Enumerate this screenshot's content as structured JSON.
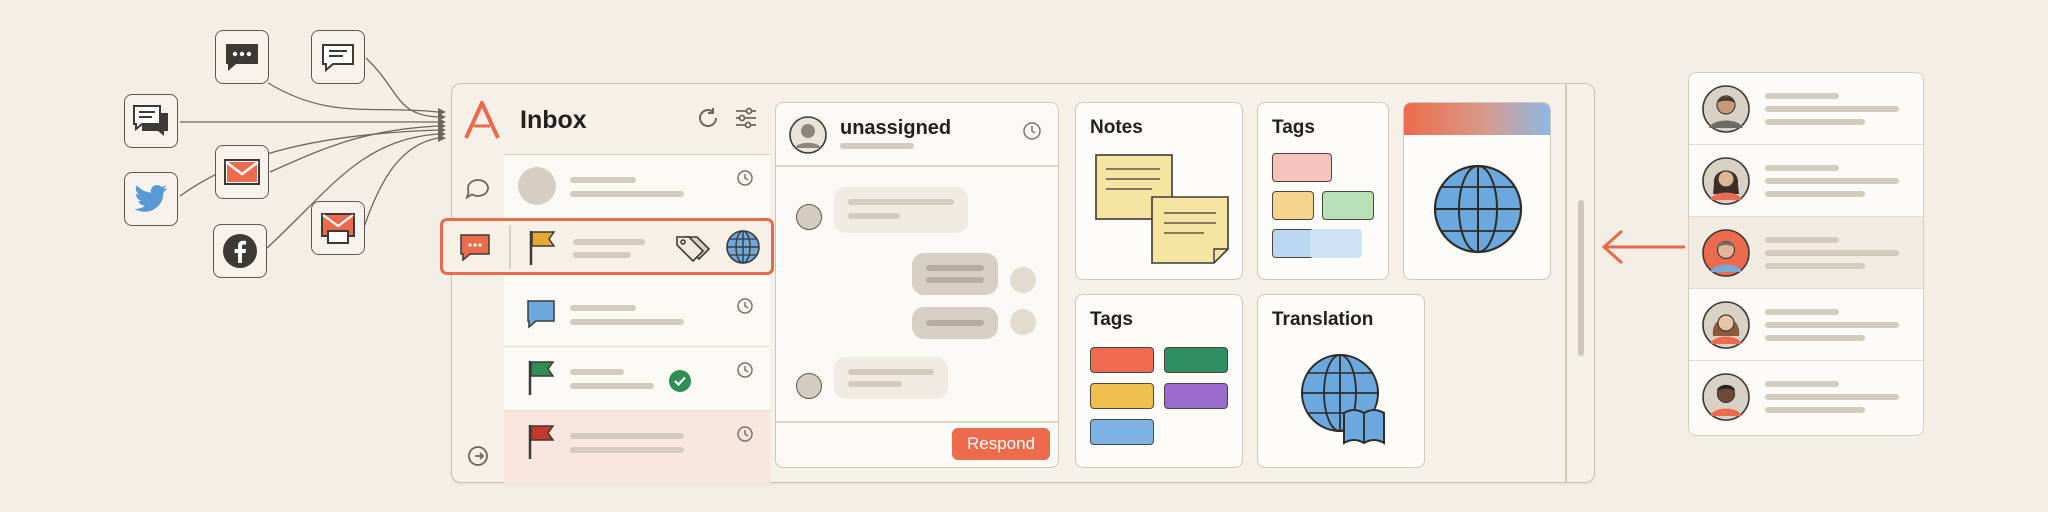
{
  "inbox": {
    "title": "Inbox"
  },
  "chat": {
    "assignee": "unassigned",
    "respond_label": "Respond"
  },
  "cards": {
    "notes_title": "Notes",
    "tags_title": "Tags",
    "tags2_title": "Tags",
    "translation_title": "Translation"
  },
  "colors": {
    "accent": "#ec6b4d",
    "highlight_border": "#e86a4a",
    "flag_yellow": "#e3aa33",
    "flag_green": "#2f8d55",
    "flag_red": "#c2382c",
    "chat_bubble_blue": "#6da8dd",
    "globe_blue": "#6aa8dd",
    "tag_red": "#ef6a4f",
    "tag_green": "#2f8e63",
    "tag_yellow": "#eec04f",
    "tag_purple": "#9b6acd",
    "tag_blue": "#7fb3e2"
  },
  "icons": {
    "channels": [
      "chat-bubble-icon",
      "message-icon",
      "sms-icon",
      "email-icon",
      "twitter-icon",
      "facebook-icon",
      "mail-inbox-icon"
    ],
    "header": [
      "refresh-icon",
      "filter-sliders-icon"
    ],
    "rail": [
      "chat-icon",
      "logout-icon"
    ]
  }
}
